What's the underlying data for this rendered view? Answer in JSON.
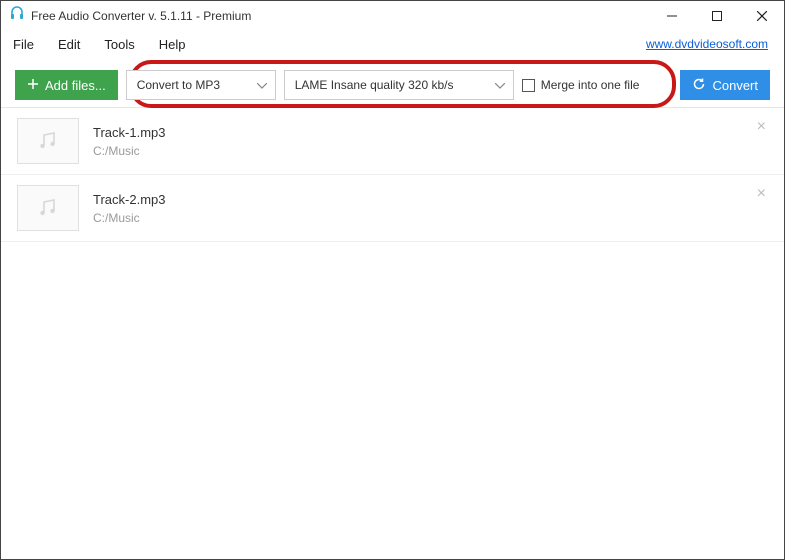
{
  "window": {
    "title": "Free Audio Converter v. 5.1.11 - Premium",
    "link": "www.dvdvideosoft.com"
  },
  "menu": {
    "items": [
      "File",
      "Edit",
      "Tools",
      "Help"
    ]
  },
  "toolbar": {
    "add_label": "Add files...",
    "format_selected": "Convert to MP3",
    "quality_selected": "LAME Insane quality 320 kb/s",
    "merge_label": "Merge into one file",
    "convert_label": "Convert"
  },
  "files": [
    {
      "name": "Track-1.mp3",
      "path": "C:/Music"
    },
    {
      "name": "Track-2.mp3",
      "path": "C:/Music"
    }
  ]
}
